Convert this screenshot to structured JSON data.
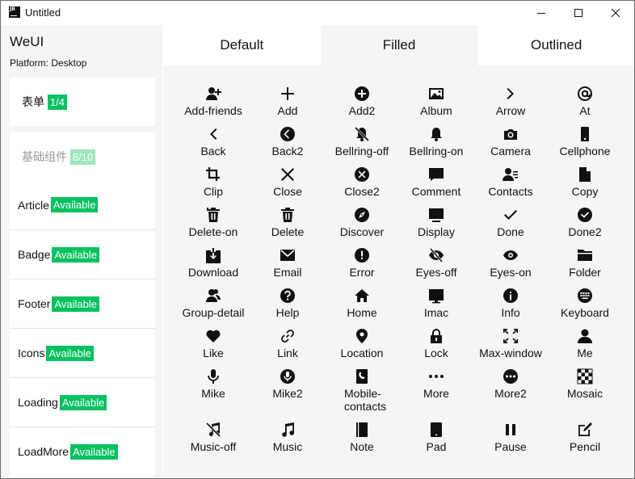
{
  "window": {
    "app_icon": "JB",
    "title": "Untitled",
    "controls": [
      "minimize-icon",
      "maximize-icon",
      "close-icon"
    ]
  },
  "sidebar": {
    "brand": "WeUI",
    "platform": "Platform: Desktop",
    "form_group": {
      "label": "表单",
      "badge": "1/4"
    },
    "basic_group": {
      "label": "基础组件",
      "badge": "8/10"
    },
    "items": [
      {
        "label": "Article",
        "badge": "Available"
      },
      {
        "label": "Badge",
        "badge": "Available"
      },
      {
        "label": "Footer",
        "badge": "Available"
      },
      {
        "label": "Icons",
        "badge": "Available"
      },
      {
        "label": "Loading",
        "badge": "Available"
      },
      {
        "label": "LoadMore",
        "badge": "Available"
      }
    ]
  },
  "tabs": [
    {
      "label": "Default",
      "active": false
    },
    {
      "label": "Filled",
      "active": true
    },
    {
      "label": "Outlined",
      "active": false
    }
  ],
  "icons": [
    {
      "label": "Add-friends",
      "icon": "add-friends-icon"
    },
    {
      "label": "Add",
      "icon": "add-icon"
    },
    {
      "label": "Add2",
      "icon": "add2-icon"
    },
    {
      "label": "Album",
      "icon": "album-icon"
    },
    {
      "label": "Arrow",
      "icon": "arrow-icon"
    },
    {
      "label": "At",
      "icon": "at-icon"
    },
    {
      "label": "Back",
      "icon": "back-icon"
    },
    {
      "label": "Back2",
      "icon": "back2-icon"
    },
    {
      "label": "Bellring-off",
      "icon": "bellring-off-icon"
    },
    {
      "label": "Bellring-on",
      "icon": "bellring-on-icon"
    },
    {
      "label": "Camera",
      "icon": "camera-icon"
    },
    {
      "label": "Cellphone",
      "icon": "cellphone-icon"
    },
    {
      "label": "Clip",
      "icon": "clip-icon"
    },
    {
      "label": "Close",
      "icon": "close-icon"
    },
    {
      "label": "Close2",
      "icon": "close2-icon"
    },
    {
      "label": "Comment",
      "icon": "comment-icon"
    },
    {
      "label": "Contacts",
      "icon": "contacts-icon"
    },
    {
      "label": "Copy",
      "icon": "copy-icon"
    },
    {
      "label": "Delete-on",
      "icon": "delete-on-icon"
    },
    {
      "label": "Delete",
      "icon": "delete-icon"
    },
    {
      "label": "Discover",
      "icon": "discover-icon"
    },
    {
      "label": "Display",
      "icon": "display-icon"
    },
    {
      "label": "Done",
      "icon": "done-icon"
    },
    {
      "label": "Done2",
      "icon": "done2-icon"
    },
    {
      "label": "Download",
      "icon": "download-icon"
    },
    {
      "label": "Email",
      "icon": "email-icon"
    },
    {
      "label": "Error",
      "icon": "error-icon"
    },
    {
      "label": "Eyes-off",
      "icon": "eyes-off-icon"
    },
    {
      "label": "Eyes-on",
      "icon": "eyes-on-icon"
    },
    {
      "label": "Folder",
      "icon": "folder-icon"
    },
    {
      "label": "Group-detail",
      "icon": "group-detail-icon"
    },
    {
      "label": "Help",
      "icon": "help-icon"
    },
    {
      "label": "Home",
      "icon": "home-icon"
    },
    {
      "label": "Imac",
      "icon": "imac-icon"
    },
    {
      "label": "Info",
      "icon": "info-icon"
    },
    {
      "label": "Keyboard",
      "icon": "keyboard-icon"
    },
    {
      "label": "Like",
      "icon": "like-icon"
    },
    {
      "label": "Link",
      "icon": "link-icon"
    },
    {
      "label": "Location",
      "icon": "location-icon"
    },
    {
      "label": "Lock",
      "icon": "lock-icon"
    },
    {
      "label": "Max-window",
      "icon": "max-window-icon"
    },
    {
      "label": "Me",
      "icon": "me-icon"
    },
    {
      "label": "Mike",
      "icon": "mike-icon"
    },
    {
      "label": "Mike2",
      "icon": "mike2-icon"
    },
    {
      "label": "Mobile-contacts",
      "icon": "mobile-contacts-icon"
    },
    {
      "label": "More",
      "icon": "more-icon"
    },
    {
      "label": "More2",
      "icon": "more2-icon"
    },
    {
      "label": "Mosaic",
      "icon": "mosaic-icon"
    },
    {
      "label": "Music-off",
      "icon": "music-off-icon"
    },
    {
      "label": "Music",
      "icon": "music-icon"
    },
    {
      "label": "Note",
      "icon": "note-icon"
    },
    {
      "label": "Pad",
      "icon": "pad-icon"
    },
    {
      "label": "Pause",
      "icon": "pause-icon"
    },
    {
      "label": "Pencil",
      "icon": "pencil-icon"
    }
  ],
  "colors": {
    "accent": "#07c160",
    "accent_muted": "#9be6bb",
    "panel_bg": "#f5f5f5",
    "icon_fill": "#111111"
  }
}
